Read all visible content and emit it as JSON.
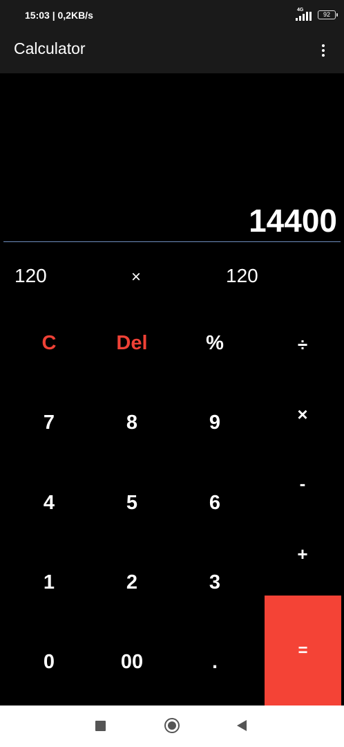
{
  "status_bar": {
    "time": "15:03 | 0,2KB/s",
    "network": "4G",
    "battery": "92"
  },
  "app_bar": {
    "title": "Calculator",
    "menu_icon": "more-vert-icon"
  },
  "display": {
    "result": "14400",
    "operand1": "120",
    "operator": "×",
    "operand2": "120"
  },
  "keypad": {
    "clear": "C",
    "delete": "Del",
    "percent": "%",
    "divide": "÷",
    "seven": "7",
    "eight": "8",
    "nine": "9",
    "multiply": "×",
    "four": "4",
    "five": "5",
    "six": "6",
    "minus": "-",
    "one": "1",
    "two": "2",
    "three": "3",
    "plus": "+",
    "zero": "0",
    "double_zero": "00",
    "decimal": ".",
    "equals": "="
  },
  "colors": {
    "accent_red": "#f44336",
    "background": "#000000",
    "bar": "#1a1a1a"
  }
}
